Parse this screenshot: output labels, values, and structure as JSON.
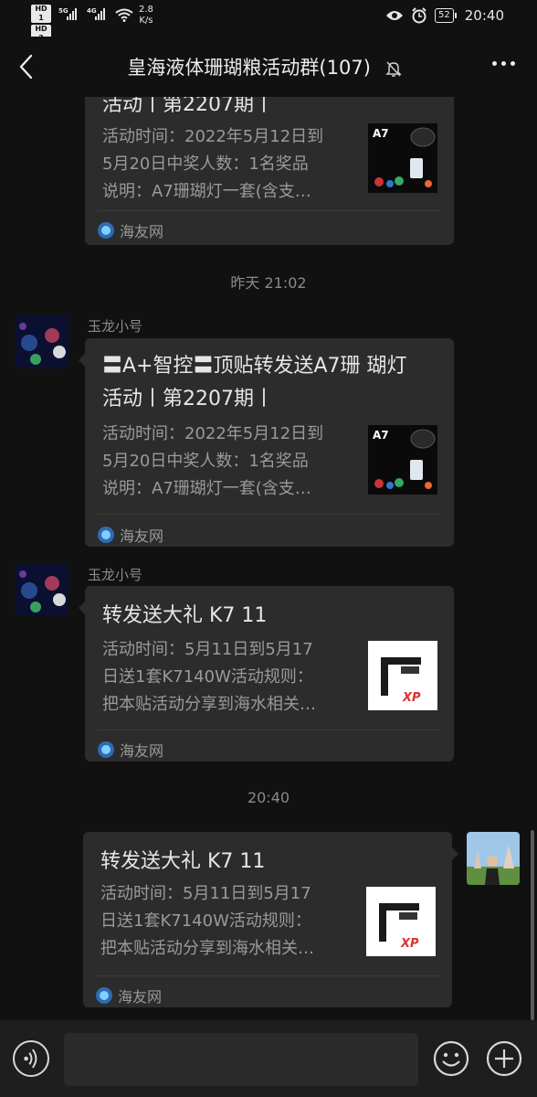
{
  "status_bar": {
    "hd1": "HD 1",
    "hd2": "HD 2",
    "net1": "5G",
    "net2": "4G",
    "speed_value": "2.8",
    "speed_unit": "K/s",
    "battery": "52",
    "clock": "20:40"
  },
  "header": {
    "title": "皇海液体珊瑚粮活动群(107)"
  },
  "messages": [
    {
      "type": "link-card",
      "title": "活动丨第2207期丨",
      "desc": "活动时间：2022年5月12日到5月20日中奖人数：1名奖品说明：A7珊瑚灯一套(含支…",
      "desc_lines": [
        "活动时间：2022年5月12日到",
        "5月20日中奖人数：1名奖品",
        "说明：A7珊瑚灯一套(含支…"
      ],
      "thumb": "A7",
      "source": "海友网"
    },
    {
      "type": "time",
      "text": "昨天 21:02"
    },
    {
      "type": "link-card",
      "sender": "玉龙小号",
      "title_lines": [
        "〓A+智控〓顶贴转发送A7珊 瑚灯",
        "活动丨第2207期丨"
      ],
      "desc_lines": [
        "活动时间：2022年5月12日到",
        "5月20日中奖人数：1名奖品",
        "说明：A7珊瑚灯一套(含支…"
      ],
      "thumb": "A7",
      "source": "海友网"
    },
    {
      "type": "link-card",
      "sender": "玉龙小号",
      "title": "转发送大礼 K7 11",
      "desc_lines": [
        "活动时间：5月11日到5月17",
        "日送1套K7140W活动规则：",
        "把本贴活动分享到海水相关…"
      ],
      "thumb": "XP",
      "source": "海友网"
    },
    {
      "type": "time",
      "text": "20:40"
    },
    {
      "type": "link-card",
      "self": true,
      "title": "转发送大礼 K7 11",
      "desc_lines": [
        "活动时间：5月11日到5月17",
        "日送1套K7140W活动规则：",
        "把本贴活动分享到海水相关…"
      ],
      "thumb": "XP",
      "source": "海友网"
    }
  ],
  "input_bar": {
    "placeholder": ""
  },
  "colors": {
    "background": "#111111",
    "card": "#2c2c2c",
    "input_bar": "#1e1e1e"
  }
}
